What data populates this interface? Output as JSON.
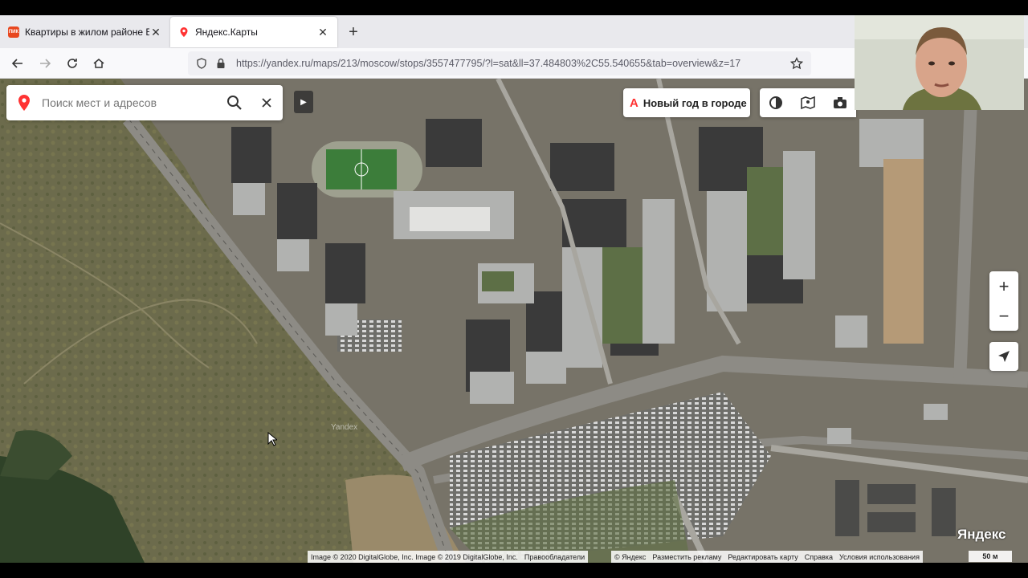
{
  "browser": {
    "tabs": [
      {
        "title": "Квартиры в жилом районе Бу",
        "favicon": "pik-icon",
        "favicon_text": "ПИК",
        "active": false
      },
      {
        "title": "Яндекс.Карты",
        "favicon": "yandex-maps-icon",
        "active": true
      }
    ],
    "url": "https://yandex.ru/maps/213/moscow/stops/3557477795/?l=sat&ll=37.484803%2C55.540655&tab=overview&z=17"
  },
  "map": {
    "search_placeholder": "Поиск мест и адресов",
    "promo_label": "Новый год в городе",
    "watermark": "Yandex",
    "brand": "Яндекс",
    "scale_label": "50 м",
    "attribution_imagery": [
      "Image © 2020 DigitalGlobe, Inc. Image © 2019 DigitalGlobe, Inc.",
      "Правообладатели"
    ],
    "attribution_links": [
      "© Яндекс",
      "Разместить рекламу",
      "Редактировать карту",
      "Справка",
      "Условия использования"
    ],
    "layer": "satellite",
    "zoom": 17
  },
  "colors": {
    "accent_red": "#ff3333",
    "tab_bar": "#e9e9ed"
  }
}
